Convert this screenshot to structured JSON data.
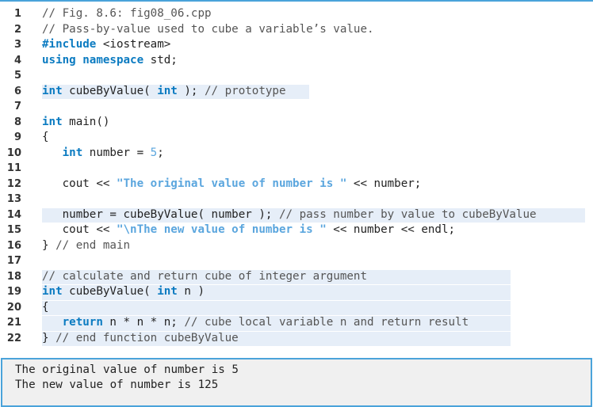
{
  "code": {
    "lines": [
      {
        "n": "1",
        "tokens": [
          {
            "t": "// Fig. 8.6: fig08_06.cpp",
            "c": "cm"
          }
        ]
      },
      {
        "n": "2",
        "tokens": [
          {
            "t": "// Pass-by-value used to cube a variable’s value.",
            "c": "cm"
          }
        ]
      },
      {
        "n": "3",
        "tokens": [
          {
            "t": "#include",
            "c": "kw"
          },
          {
            "t": " <iostream>",
            "c": ""
          }
        ]
      },
      {
        "n": "4",
        "tokens": [
          {
            "t": "using namespace",
            "c": "kw"
          },
          {
            "t": " std;",
            "c": ""
          }
        ]
      },
      {
        "n": "5",
        "tokens": []
      },
      {
        "n": "6",
        "hl": "proto",
        "tokens": [
          {
            "t": "int",
            "c": "kw"
          },
          {
            "t": " cubeByValue( ",
            "c": ""
          },
          {
            "t": "int",
            "c": "kw"
          },
          {
            "t": " ); ",
            "c": ""
          },
          {
            "t": "// prototype",
            "c": "cm"
          }
        ]
      },
      {
        "n": "7",
        "tokens": []
      },
      {
        "n": "8",
        "tokens": [
          {
            "t": "int",
            "c": "kw"
          },
          {
            "t": " main()",
            "c": ""
          }
        ]
      },
      {
        "n": "9",
        "tokens": [
          {
            "t": "{",
            "c": ""
          }
        ]
      },
      {
        "n": "10",
        "tokens": [
          {
            "t": "   ",
            "c": ""
          },
          {
            "t": "int",
            "c": "kw"
          },
          {
            "t": " number = ",
            "c": ""
          },
          {
            "t": "5",
            "c": "num"
          },
          {
            "t": ";",
            "c": ""
          }
        ]
      },
      {
        "n": "11",
        "tokens": []
      },
      {
        "n": "12",
        "tokens": [
          {
            "t": "   cout << ",
            "c": ""
          },
          {
            "t": "\"The original value of number is \"",
            "c": "str"
          },
          {
            "t": " << number;",
            "c": ""
          }
        ]
      },
      {
        "n": "13",
        "tokens": []
      },
      {
        "n": "14",
        "hl": "call",
        "tokens": [
          {
            "t": "   number = cubeByValue( number ); ",
            "c": ""
          },
          {
            "t": "// pass number by value to cubeByValue",
            "c": "cm"
          }
        ]
      },
      {
        "n": "15",
        "tokens": [
          {
            "t": "   cout << ",
            "c": ""
          },
          {
            "t": "\"\\nThe new value of number is \"",
            "c": "str"
          },
          {
            "t": " << number << endl;",
            "c": ""
          }
        ]
      },
      {
        "n": "16",
        "tokens": [
          {
            "t": "} ",
            "c": ""
          },
          {
            "t": "// end main",
            "c": "cm"
          }
        ]
      },
      {
        "n": "17",
        "tokens": []
      },
      {
        "n": "18",
        "hl": "func",
        "tokens": [
          {
            "t": "// calculate and return cube of integer argument",
            "c": "cm"
          }
        ]
      },
      {
        "n": "19",
        "hl": "func",
        "tokens": [
          {
            "t": "int",
            "c": "kw"
          },
          {
            "t": " cubeByValue( ",
            "c": ""
          },
          {
            "t": "int",
            "c": "kw"
          },
          {
            "t": " n )",
            "c": ""
          }
        ]
      },
      {
        "n": "20",
        "hl": "func",
        "tokens": [
          {
            "t": "{",
            "c": ""
          }
        ]
      },
      {
        "n": "21",
        "hl": "func",
        "tokens": [
          {
            "t": "   ",
            "c": ""
          },
          {
            "t": "return",
            "c": "kw"
          },
          {
            "t": " n * n * n; ",
            "c": ""
          },
          {
            "t": "// cube local variable n and return result",
            "c": "cm"
          }
        ]
      },
      {
        "n": "22",
        "hl": "func",
        "tokens": [
          {
            "t": "} ",
            "c": ""
          },
          {
            "t": "// end function cubeByValue",
            "c": "cm"
          }
        ]
      }
    ]
  },
  "output": {
    "lines": [
      "The original value of number is 5",
      "The new value of number is 125"
    ]
  },
  "colors": {
    "keyword": "#0b7bc1",
    "string": "#5ba6de",
    "comment": "#555555",
    "highlight": "#e6eef8",
    "border": "#4aa3da",
    "output_bg": "#f0f0f0"
  }
}
